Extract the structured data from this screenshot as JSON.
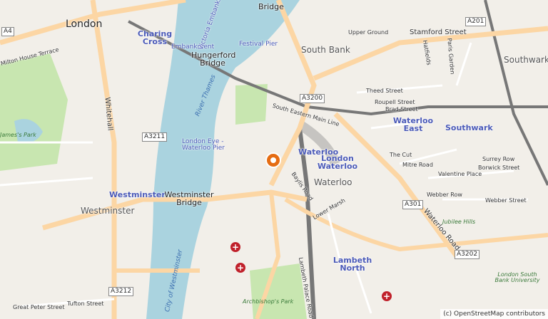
{
  "map": {
    "places": {
      "london": "London",
      "south_bank": "South Bank",
      "westminster": "Westminster",
      "waterloo": "Waterloo",
      "southwark": "Southwark",
      "jubilee_hills": "Jubilee Hills",
      "london_south_bank_university": "London South Bank University",
      "archbishops_park": "Archbishop's Park",
      "james_park": "James's Park"
    },
    "stations": {
      "charing_cross": "Charing Cross",
      "embankment": "Embankment",
      "festival_pier": "Festival Pier",
      "london_eye_waterloo_pier": "London Eye - Waterloo Pier",
      "westminster_station": "Westminster",
      "waterloo_station": "Waterloo",
      "london_waterloo": "London Waterloo",
      "waterloo_east": "Waterloo East",
      "southwark_station": "Southwark",
      "lambeth_north": "Lambeth North",
      "victoria_embankment": "Victoria Embankment"
    },
    "bridges": {
      "hungerford": "Hungerford Bridge",
      "westminster": "Westminster Bridge",
      "blackfriars_partial": "Bridge"
    },
    "rivers": {
      "thames": "River Thames",
      "city_of_westminster": "City of Westminster"
    },
    "streets": [
      "Stamford Street",
      "Upper Ground",
      "Theed Street",
      "Roupell Street",
      "Brad Street",
      "The Cut",
      "Mitre Road",
      "Valentine Place",
      "Webber Row",
      "Webber Street",
      "Surrey Row",
      "Borwick Street",
      "Waterloo Road",
      "Lower Marsh",
      "Whitehall",
      "Great Peter Street",
      "Tufton Street",
      "Hatfields",
      "Paris Garden",
      "South Eastern Main Line",
      "Lambeth Palace Road",
      "Baylis Road",
      "Milton House Terrace"
    ],
    "road_shields": [
      "A4",
      "A201",
      "A3200",
      "A3211",
      "A301",
      "A3202",
      "A3212"
    ],
    "attribution": "(c) OpenStreetMap contributors"
  }
}
